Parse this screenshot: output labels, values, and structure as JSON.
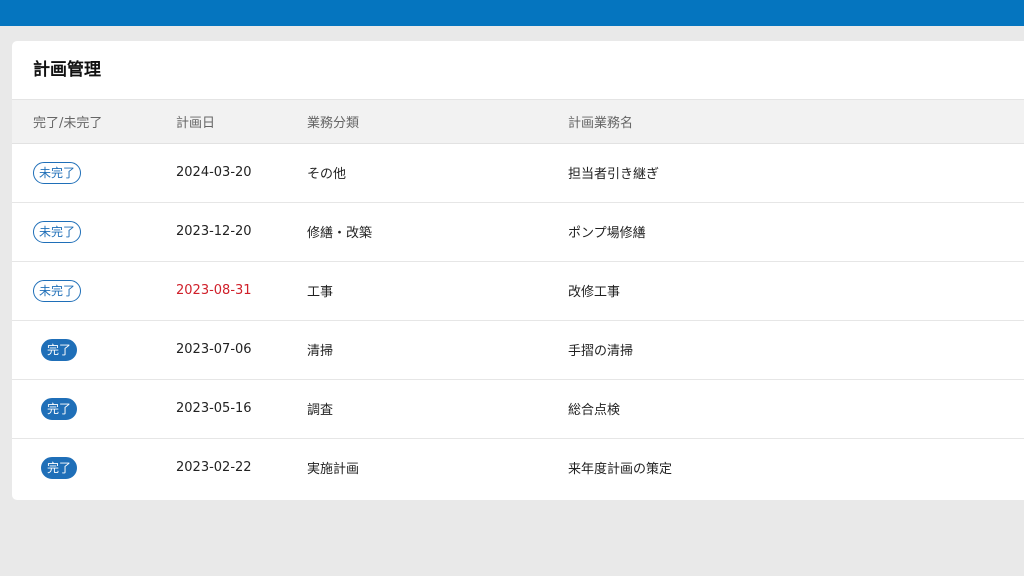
{
  "header": {
    "title": "計画管理"
  },
  "table": {
    "columns": [
      "完了/未完了",
      "計画日",
      "業務分類",
      "計画業務名"
    ],
    "rows": [
      {
        "status": "未完了",
        "status_type": "incomplete",
        "date": "2024-03-20",
        "overdue": false,
        "category": "その他",
        "name": "担当者引き継ぎ"
      },
      {
        "status": "未完了",
        "status_type": "incomplete",
        "date": "2023-12-20",
        "overdue": false,
        "category": "修繕・改築",
        "name": "ポンプ場修繕"
      },
      {
        "status": "未完了",
        "status_type": "incomplete",
        "date": "2023-08-31",
        "overdue": true,
        "category": "工事",
        "name": "改修工事"
      },
      {
        "status": "完了",
        "status_type": "complete",
        "date": "2023-07-06",
        "overdue": false,
        "category": "清掃",
        "name": "手摺の清掃"
      },
      {
        "status": "完了",
        "status_type": "complete",
        "date": "2023-05-16",
        "overdue": false,
        "category": "調査",
        "name": "総合点検"
      },
      {
        "status": "完了",
        "status_type": "complete",
        "date": "2023-02-22",
        "overdue": false,
        "category": "実施計画",
        "name": "来年度計画の策定"
      }
    ]
  },
  "colors": {
    "header_bar": "#0575bf",
    "badge": "#1f6fb8",
    "overdue": "#d0202a"
  }
}
